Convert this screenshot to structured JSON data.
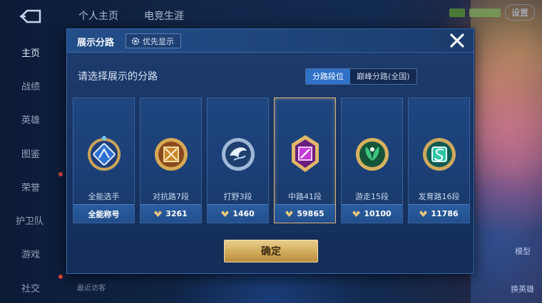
{
  "header": {
    "tabs": [
      "个人主页",
      "电竞生涯"
    ],
    "settings_label": "设置"
  },
  "nav": {
    "items": [
      "主页",
      "战绩",
      "英雄",
      "图鉴",
      "荣誉",
      "护卫队",
      "游戏",
      "社交"
    ]
  },
  "side": {
    "label_a": "模型",
    "label_b": "换英雄"
  },
  "bottom": {
    "visitors": "最近访客"
  },
  "dialog": {
    "title": "展示分路",
    "priority_label": "优先显示",
    "subtitle": "请选择展示的分路",
    "toggle": [
      "分路段位",
      "巅峰分路(全国)"
    ],
    "confirm": "确定",
    "cards": [
      {
        "label": "全能选手",
        "foot": "全能称号",
        "badge_color": "#2f6fd2"
      },
      {
        "label": "对抗路7段",
        "foot": "3261",
        "badge_color": "#c9862b"
      },
      {
        "label": "打野3段",
        "foot": "1460",
        "badge_color": "#7fa7d8"
      },
      {
        "label": "中路41段",
        "foot": "59865",
        "badge_color": "#c23bd6"
      },
      {
        "label": "游走15段",
        "foot": "10100",
        "badge_color": "#2a9a5a"
      },
      {
        "label": "发育路16段",
        "foot": "11786",
        "badge_color": "#2cc6a6"
      }
    ]
  },
  "colors": {
    "accent_gold": "#d9b378",
    "toggle_active": "#2f72c8"
  }
}
